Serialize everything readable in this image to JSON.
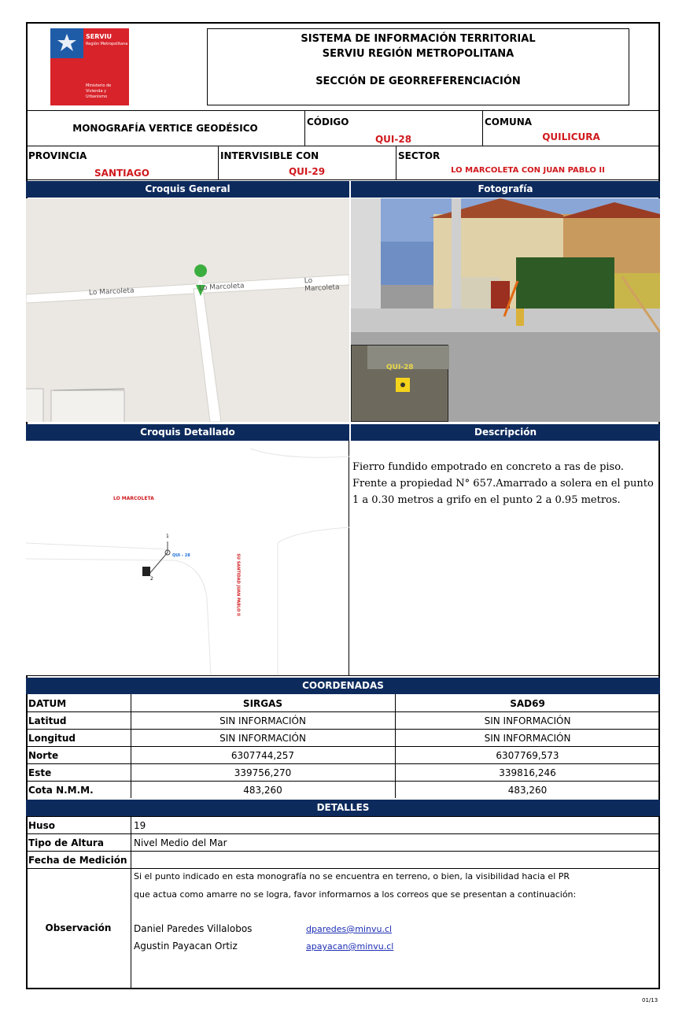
{
  "logo": {
    "brand": "SERVIU",
    "region": "Región Metropolitana",
    "ministry": [
      "Ministerio de",
      "Vivienda y",
      "Urbanismo"
    ]
  },
  "header": {
    "line1": "SISTEMA DE INFORMACIÓN TERRITORIAL",
    "line2": "SERVIU REGIÓN METROPOLITANA",
    "line3": "SECCIÓN  DE GEORREFERENCIACIÓN"
  },
  "info": {
    "title": "MONOGRAFÍA VERTICE GEODÉSICO",
    "codigo_label": "CÓDIGO",
    "codigo": "QUI-28",
    "comuna_label": "COMUNA",
    "comuna": "QUILICURA",
    "provincia_label": "PROVINCIA",
    "provincia": "SANTIAGO",
    "intervisible_label": "INTERVISIBLE CON",
    "intervisible": "QUI-29",
    "sector_label": "SECTOR",
    "sector": "LO MARCOLETA CON JUAN PABLO II"
  },
  "sections": {
    "croquis_general": "Croquis General",
    "fotografia": "Fotografía",
    "croquis_detallado": "Croquis Detallado",
    "descripcion": "Descripción",
    "coordenadas": "COORDENADAS",
    "detalles": "DETALLES"
  },
  "map": {
    "street1": "Lo Marcoleta",
    "street2": "Lo Marcoleta",
    "street3": "Lo Marcoleta",
    "marker": "A"
  },
  "photo": {
    "inset_label": "QUI-28"
  },
  "sketch": {
    "street_a": "LO MARCOLETA",
    "street_b": "SU SANTIDAD JUAN PABLO II",
    "point_label": "QUI - 28",
    "p1": "1",
    "p2": "2"
  },
  "descripcion": "Fierro fundido empotrado en concreto a ras de piso. Frente a propiedad N° 657.Amarrado a solera en el punto 1 a 0.30 metros a grifo en el punto 2 a 0.95 metros.",
  "coords": {
    "headers": [
      "DATUM",
      "SIRGAS",
      "SAD69"
    ],
    "rows": [
      {
        "label": "Latitud",
        "sirgas": "SIN INFORMACIÓN",
        "sad69": "SIN INFORMACIÓN"
      },
      {
        "label": "Longitud",
        "sirgas": "SIN INFORMACIÓN",
        "sad69": "SIN INFORMACIÓN"
      },
      {
        "label": "Norte",
        "sirgas": "6307744,257",
        "sad69": "6307769,573"
      },
      {
        "label": "Este",
        "sirgas": "339756,270",
        "sad69": "339816,246"
      },
      {
        "label": "Cota N.M.M.",
        "sirgas": "483,260",
        "sad69": "483,260"
      }
    ]
  },
  "detalles": {
    "huso_label": "Huso",
    "huso": "19",
    "altura_label": "Tipo de Altura",
    "altura": "Nivel Medio del Mar",
    "fecha_label": "Fecha de Medición",
    "fecha": "",
    "obs_label": "Observación",
    "obs_line1": "Si el punto indicado en esta monografía no se encuentra en terreno, o bien, la visibilidad hacia el PR",
    "obs_line2": "que actua como amarre no se logra, favor informarnos a los correos que se presentan a continuación:",
    "contact1_name": "Daniel Paredes Villalobos",
    "contact1_email": "dparedes@minvu.cl",
    "contact2_name": "Agustin Payacan Ortiz",
    "contact2_email": "apayacan@minvu.cl"
  },
  "page_number": "01/13"
}
